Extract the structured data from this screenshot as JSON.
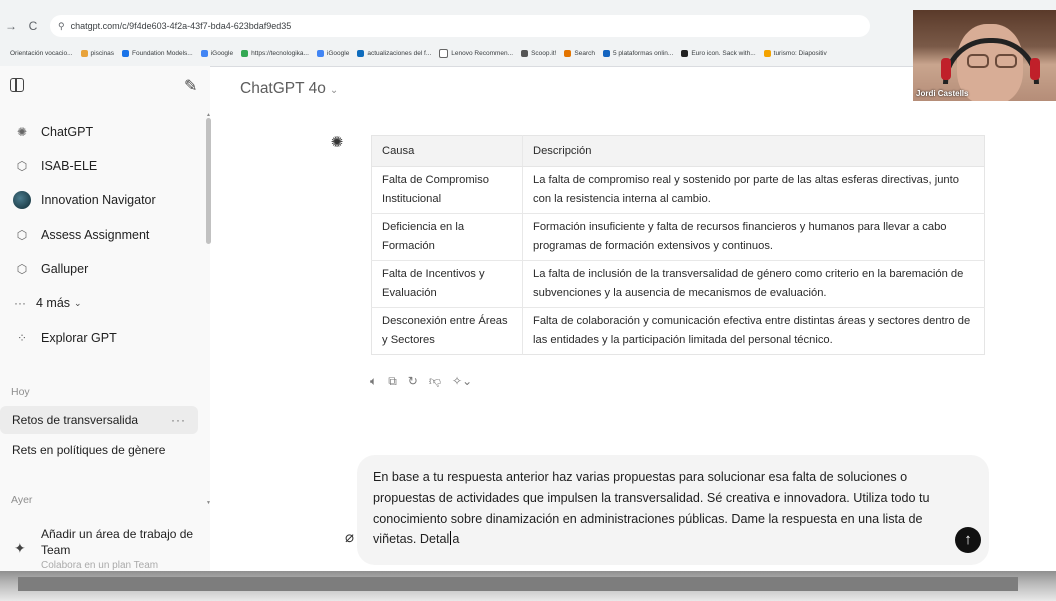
{
  "browser": {
    "url": "chatgpt.com/c/9f4de603-4f2a-43f7-bda4-623bdaf9ed35",
    "bookmarks": [
      "Orientación vocacio...",
      "piscinas",
      "Foundation Models...",
      "iGoogle",
      "https://tecnologika...",
      "iGoogle",
      "actualizaciones del f...",
      "Lenovo Recommen...",
      "Scoop.it!",
      "Search",
      "5 plataformas onlin...",
      "Euro icon. Sack with...",
      "turismo: Diapositiv"
    ]
  },
  "sidebar": {
    "gpts": [
      {
        "label": "ChatGPT",
        "icon": "openai-logo-icon"
      },
      {
        "label": "ISAB-ELE",
        "icon": "cube-icon"
      },
      {
        "label": "Innovation Navigator",
        "icon": "avatar"
      },
      {
        "label": "Assess Assignment",
        "icon": "cube-icon"
      },
      {
        "label": "Galluper",
        "icon": "cube-icon"
      }
    ],
    "more": "4 más",
    "explore": "Explorar GPT",
    "section_today": "Hoy",
    "chats_today": [
      "Retos de transversalida",
      "Rets en polítiques de gènere"
    ],
    "section_yesterday": "Ayer",
    "upsell_title": "Añadir un área de trabajo de Team",
    "upsell_sub": "Colabora en un plan Team"
  },
  "main": {
    "model": "ChatGPT 4o",
    "table": {
      "headers": [
        "Causa",
        "Descripción"
      ],
      "rows": [
        [
          "Falta de Compromiso Institucional",
          "La falta de compromiso real y sostenido por parte de las altas esferas directivas, junto con la resistencia interna al cambio."
        ],
        [
          "Deficiencia en la Formación",
          "Formación insuficiente y falta de recursos financieros y humanos para llevar a cabo programas de formación extensivos y continuos."
        ],
        [
          "Falta de Incentivos y Evaluación",
          "La falta de inclusión de la transversalidad de género como criterio en la baremación de subvenciones y la ausencia de mecanismos de evaluación."
        ],
        [
          "Desconexión entre Áreas y Sectores",
          "Falta de colaboración y comunicación efectiva entre distintas áreas y sectores dentro de las entidades y la participación limitada del personal técnico."
        ]
      ]
    },
    "composer_text_a": "En base a tu respuesta anterior haz varias propuestas para solucionar esa falta de soluciones o propuestas de actividades que impulsen la transversalidad. Sé creativa e innovadora. Utiliza todo tu conocimiento sobre dinamización en administraciones públicas.  Dame la respuesta en una lista de viñetas. Detal",
    "composer_text_b": "a"
  },
  "webcam": {
    "name": "Jordi Castells"
  },
  "colors": {
    "accent": "#111111",
    "sidebar_bg": "#f9f9f9",
    "composer_bg": "#f4f4f4"
  }
}
